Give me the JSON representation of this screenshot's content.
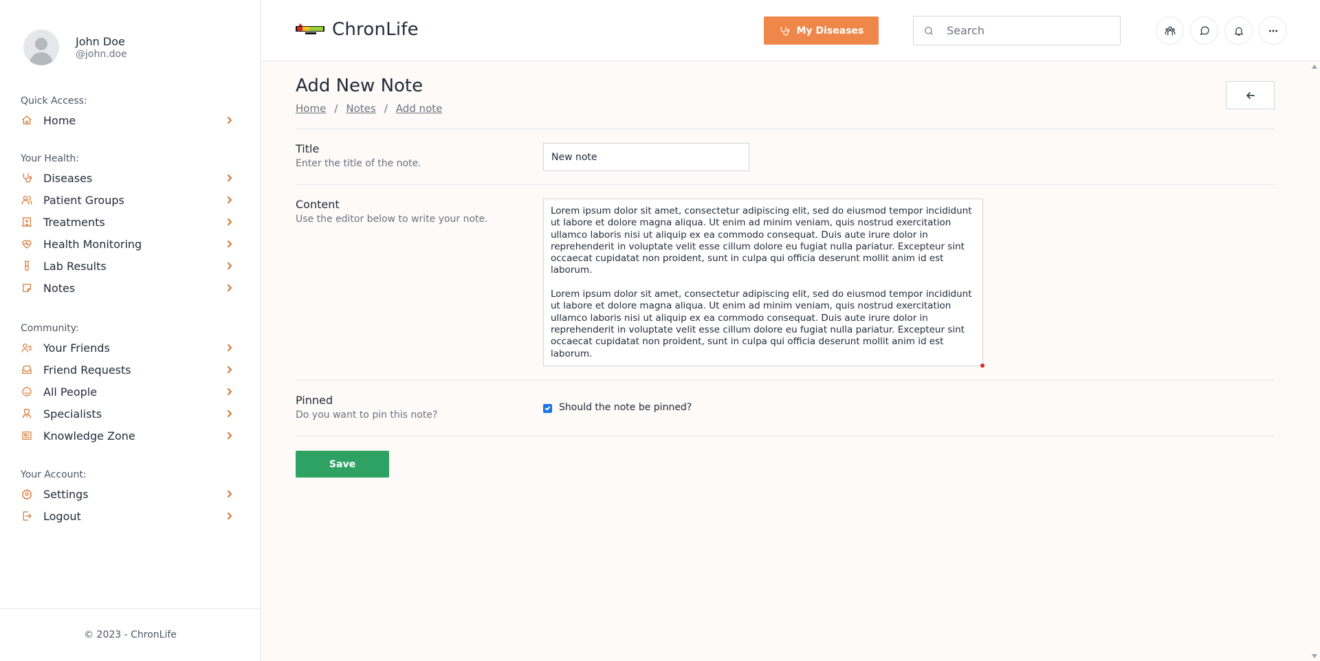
{
  "user": {
    "name": "John Doe",
    "handle": "@john.doe"
  },
  "sidebar": {
    "quick_access": {
      "heading": "Quick Access:",
      "items": [
        {
          "label": "Home",
          "icon": "home-icon"
        }
      ]
    },
    "your_health": {
      "heading": "Your Health:",
      "items": [
        {
          "label": "Diseases",
          "icon": "stethoscope-icon"
        },
        {
          "label": "Patient Groups",
          "icon": "users-icon"
        },
        {
          "label": "Treatments",
          "icon": "hospital-icon"
        },
        {
          "label": "Health Monitoring",
          "icon": "heart-pulse-icon"
        },
        {
          "label": "Lab Results",
          "icon": "test-tube-icon"
        },
        {
          "label": "Notes",
          "icon": "sticky-note-icon"
        }
      ]
    },
    "community": {
      "heading": "Community:",
      "items": [
        {
          "label": "Your Friends",
          "icon": "user-list-icon"
        },
        {
          "label": "Friend Requests",
          "icon": "inbox-icon"
        },
        {
          "label": "All People",
          "icon": "smile-icon"
        },
        {
          "label": "Specialists",
          "icon": "doctor-icon"
        },
        {
          "label": "Knowledge Zone",
          "icon": "newspaper-icon"
        }
      ]
    },
    "account": {
      "heading": "Your Account:",
      "items": [
        {
          "label": "Settings",
          "icon": "gear-icon"
        },
        {
          "label": "Logout",
          "icon": "logout-icon"
        }
      ]
    },
    "footer": "© 2023 - ChronLife"
  },
  "topbar": {
    "logo_text": "ChronLife",
    "my_diseases_label": "My Diseases",
    "search_placeholder": "Search"
  },
  "page": {
    "title": "Add New Note",
    "breadcrumb": [
      "Home",
      "Notes",
      "Add note"
    ],
    "breadcrumb_sep": "/"
  },
  "form": {
    "title": {
      "label": "Title",
      "help": "Enter the title of the note.",
      "value": "New note"
    },
    "content": {
      "label": "Content",
      "help": "Use the editor below to write your note.",
      "paragraphs": [
        "Lorem ipsum dolor sit amet, consectetur adipiscing elit, sed do eiusmod tempor incididunt ut labore et dolore magna aliqua. Ut enim ad minim veniam, quis nostrud exercitation ullamco laboris nisi ut aliquip ex ea commodo consequat. Duis aute irure dolor in reprehenderit in voluptate velit esse cillum dolore eu fugiat nulla pariatur. Excepteur sint occaecat cupidatat non proident, sunt in culpa qui officia deserunt mollit anim id est laborum.",
        "Lorem ipsum dolor sit amet, consectetur adipiscing elit, sed do eiusmod tempor incididunt ut labore et dolore magna aliqua. Ut enim ad minim veniam, quis nostrud exercitation ullamco laboris nisi ut aliquip ex ea commodo consequat. Duis aute irure dolor in reprehenderit in voluptate velit esse cillum dolore eu fugiat nulla pariatur. Excepteur sint occaecat cupidatat non proident, sunt in culpa qui officia deserunt mollit anim id est laborum."
      ]
    },
    "pinned": {
      "label": "Pinned",
      "help": "Do you want to pin this note?",
      "checkbox_label": "Should the note be pinned?",
      "checked": true
    },
    "save_label": "Save"
  },
  "colors": {
    "accent": "#f0874a",
    "icon": "#d4722e",
    "save": "#2ea263",
    "checkbox": "#1a73e8"
  }
}
